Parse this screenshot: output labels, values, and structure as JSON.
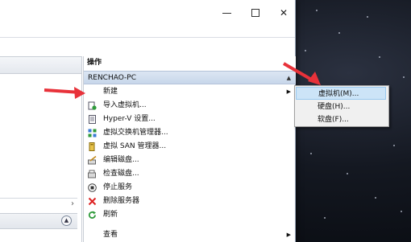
{
  "window": {
    "controls": {
      "minimize_icon": "minimize-icon",
      "maximize_icon": "maximize-icon",
      "close_glyph": "✕"
    }
  },
  "actions_pane": {
    "title": "操作",
    "group_header": "RENCHAO-PC",
    "group_caret": "▲",
    "items": [
      {
        "label": "新建",
        "icon": "none",
        "submenu_arrow": "▶"
      },
      {
        "label": "导入虚拟机...",
        "icon": "import-icon"
      },
      {
        "label": "Hyper-V 设置...",
        "icon": "settings-page-icon"
      },
      {
        "label": "虚拟交换机管理器...",
        "icon": "switch-manager-icon"
      },
      {
        "label": "虚拟 SAN 管理器...",
        "icon": "san-manager-icon"
      },
      {
        "label": "编辑磁盘...",
        "icon": "edit-disk-icon"
      },
      {
        "label": "检查磁盘...",
        "icon": "inspect-disk-icon"
      },
      {
        "label": "停止服务",
        "icon": "stop-service-icon"
      },
      {
        "label": "删除服务器",
        "icon": "delete-server-icon"
      },
      {
        "label": "刷新",
        "icon": "refresh-icon"
      },
      {
        "label": "查看",
        "icon": "none",
        "submenu_arrow": "▶"
      }
    ]
  },
  "left_pane": {
    "scroll_arrow": "›",
    "footer_toggle_glyph": "▲"
  },
  "submenu": {
    "items": [
      {
        "label": "虚拟机(M)..."
      },
      {
        "label": "硬盘(H)..."
      },
      {
        "label": "软盘(F)..."
      }
    ]
  },
  "colors": {
    "annotation_arrow": "#e8323a",
    "group_header_bg": "#c7d6ea",
    "submenu_highlight": "#cce4f7"
  }
}
